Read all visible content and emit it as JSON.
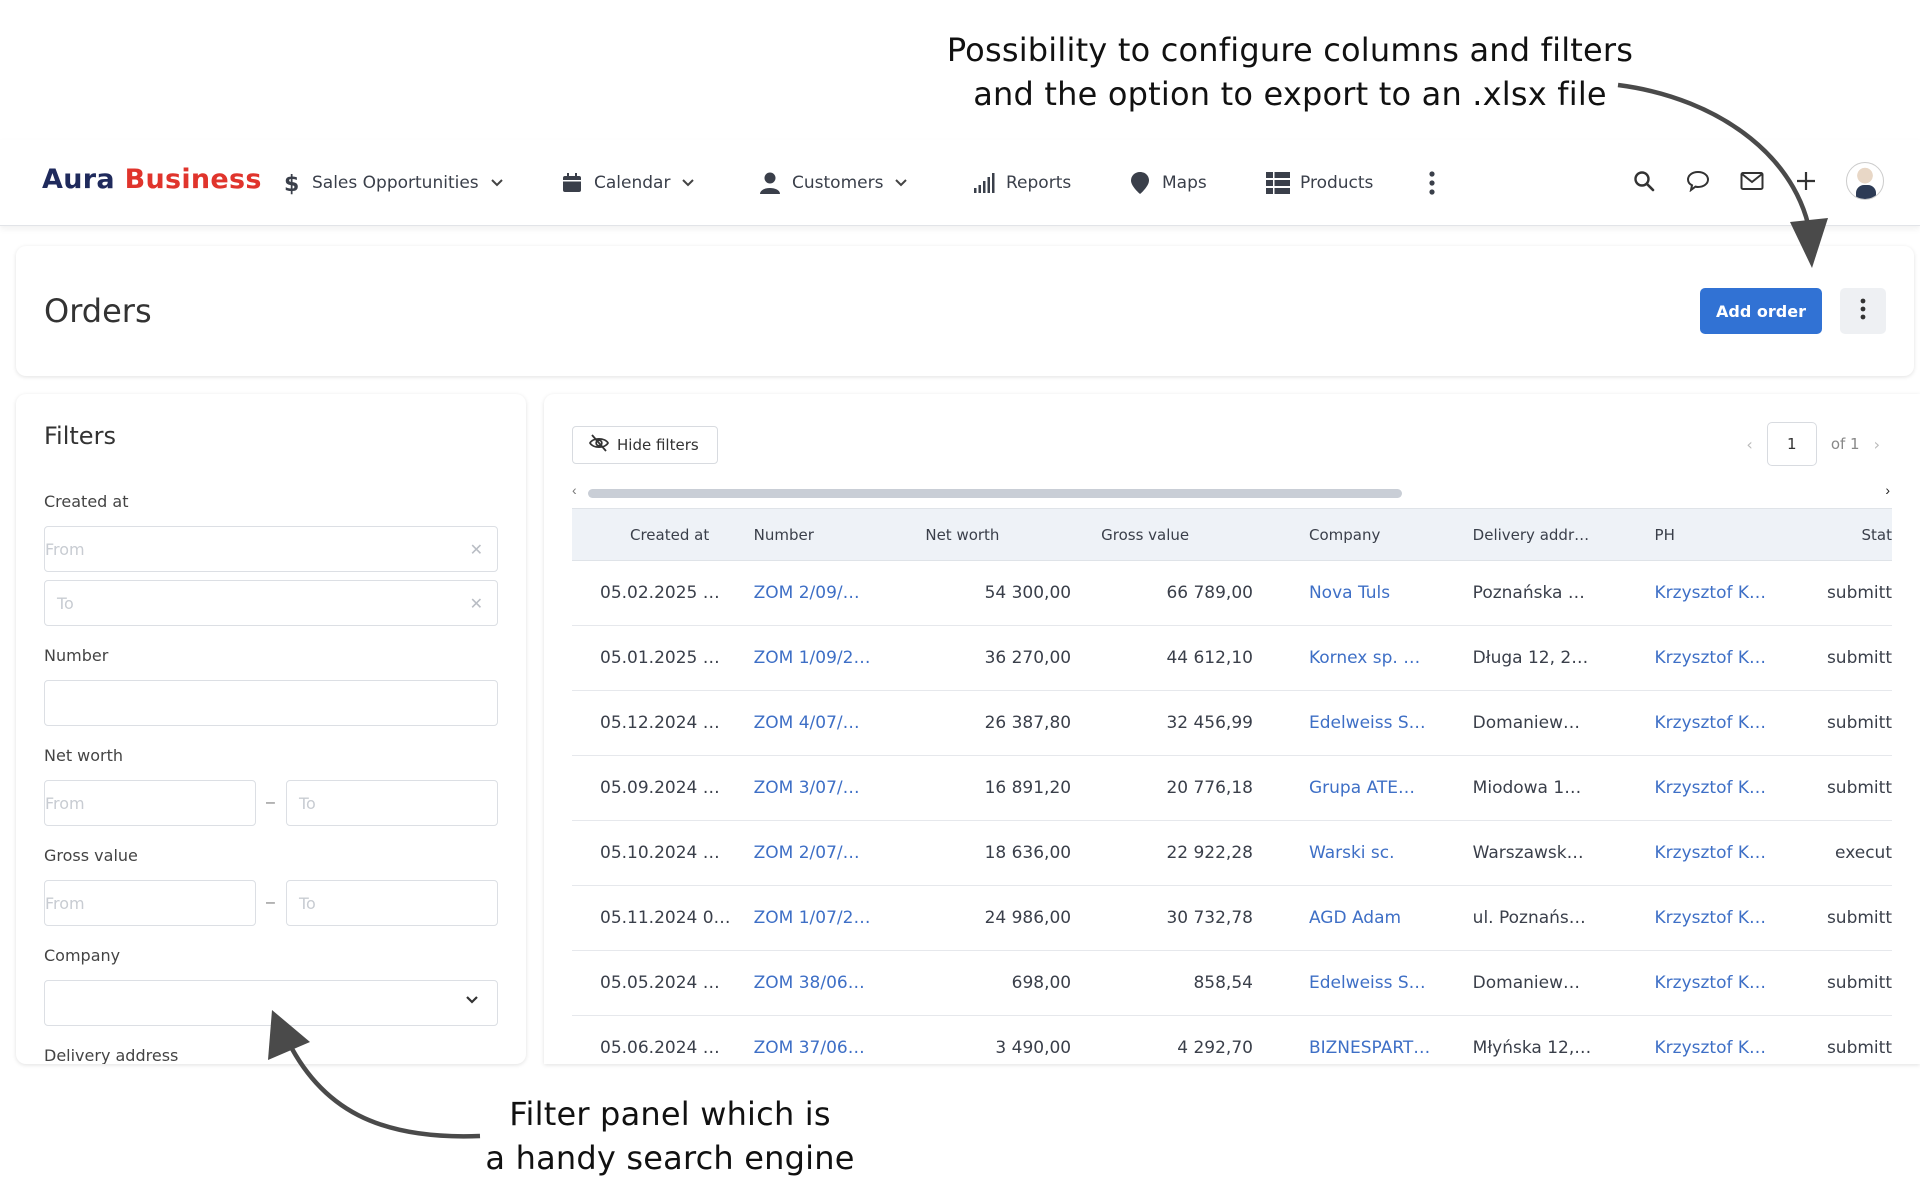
{
  "annotations": {
    "top_line1": "Possibility to configure columns and filters",
    "top_line2": "and the option to export to an .xlsx file",
    "bottom_line1": "Filter panel which is",
    "bottom_line2": "a handy search engine"
  },
  "brand": {
    "part1": "Aura",
    "part2": "Business",
    "color1": "#1f2a5c",
    "color2": "#e0342c"
  },
  "nav": {
    "items": [
      {
        "label": "Sales Opportunities",
        "icon": "dollar-icon",
        "dropdown": true
      },
      {
        "label": "Calendar",
        "icon": "calendar-icon",
        "dropdown": true
      },
      {
        "label": "Customers",
        "icon": "person-icon",
        "dropdown": true
      },
      {
        "label": "Reports",
        "icon": "bars-icon",
        "dropdown": false
      },
      {
        "label": "Maps",
        "icon": "map-pin-icon",
        "dropdown": false
      },
      {
        "label": "Products",
        "icon": "grid-icon",
        "dropdown": false
      }
    ],
    "right_icons": [
      "search-icon",
      "chat-icon",
      "mail-icon",
      "plus-icon",
      "avatar"
    ]
  },
  "page": {
    "title": "Orders",
    "add_button": "Add order",
    "accent": "#3172d4"
  },
  "filters": {
    "title": "Filters",
    "created_at": {
      "label": "Created at",
      "from_placeholder": "From",
      "to_placeholder": "To"
    },
    "number": {
      "label": "Number",
      "value": ""
    },
    "net_worth": {
      "label": "Net worth",
      "from_placeholder": "From",
      "to_placeholder": "To",
      "separator": "–"
    },
    "gross_value": {
      "label": "Gross value",
      "from_placeholder": "From",
      "to_placeholder": "To",
      "separator": "–"
    },
    "company": {
      "label": "Company",
      "value": ""
    },
    "delivery_address": {
      "label": "Delivery address"
    }
  },
  "toolbar": {
    "hide_filters": "Hide filters"
  },
  "pagination": {
    "current": "1",
    "of_label": "of 1"
  },
  "table": {
    "columns": [
      "Created at",
      "Number",
      "Net worth",
      "Gross value",
      "Company",
      "Delivery addr…",
      "PH",
      "Stat"
    ],
    "rows": [
      [
        "05.02.2025 …",
        "ZOM 2/09/…",
        "54 300,00",
        "66 789,00",
        "Nova Tuls",
        "Poznańska …",
        "Krzysztof K…",
        "submitt"
      ],
      [
        "05.01.2025 …",
        "ZOM 1/09/2…",
        "36 270,00",
        "44 612,10",
        "Kornex sp. …",
        "Długa 12, 2…",
        "Krzysztof K…",
        "submitt"
      ],
      [
        "05.12.2024 …",
        "ZOM 4/07/…",
        "26 387,80",
        "32 456,99",
        "Edelweiss S…",
        "Domaniew…",
        "Krzysztof K…",
        "submitt"
      ],
      [
        "05.09.2024 …",
        "ZOM 3/07/…",
        "16 891,20",
        "20 776,18",
        "Grupa ATE…",
        "Miodowa 1…",
        "Krzysztof K…",
        "submitt"
      ],
      [
        "05.10.2024 …",
        "ZOM 2/07/…",
        "18 636,00",
        "22 922,28",
        "Warski sc.",
        "Warszawsk…",
        "Krzysztof K…",
        "execut"
      ],
      [
        "05.11.2024 0…",
        "ZOM 1/07/2…",
        "24 986,00",
        "30 732,78",
        "AGD Adam",
        "ul. Poznańs…",
        "Krzysztof K…",
        "submitt"
      ],
      [
        "05.05.2024 …",
        "ZOM 38/06…",
        "698,00",
        "858,54",
        "Edelweiss S…",
        "Domaniew…",
        "Krzysztof K…",
        "submitt"
      ],
      [
        "05.06.2024 …",
        "ZOM 37/06…",
        "3 490,00",
        "4 292,70",
        "BIZNESPART…",
        "Młyńska 12,…",
        "Krzysztof K…",
        "submitt"
      ]
    ]
  }
}
